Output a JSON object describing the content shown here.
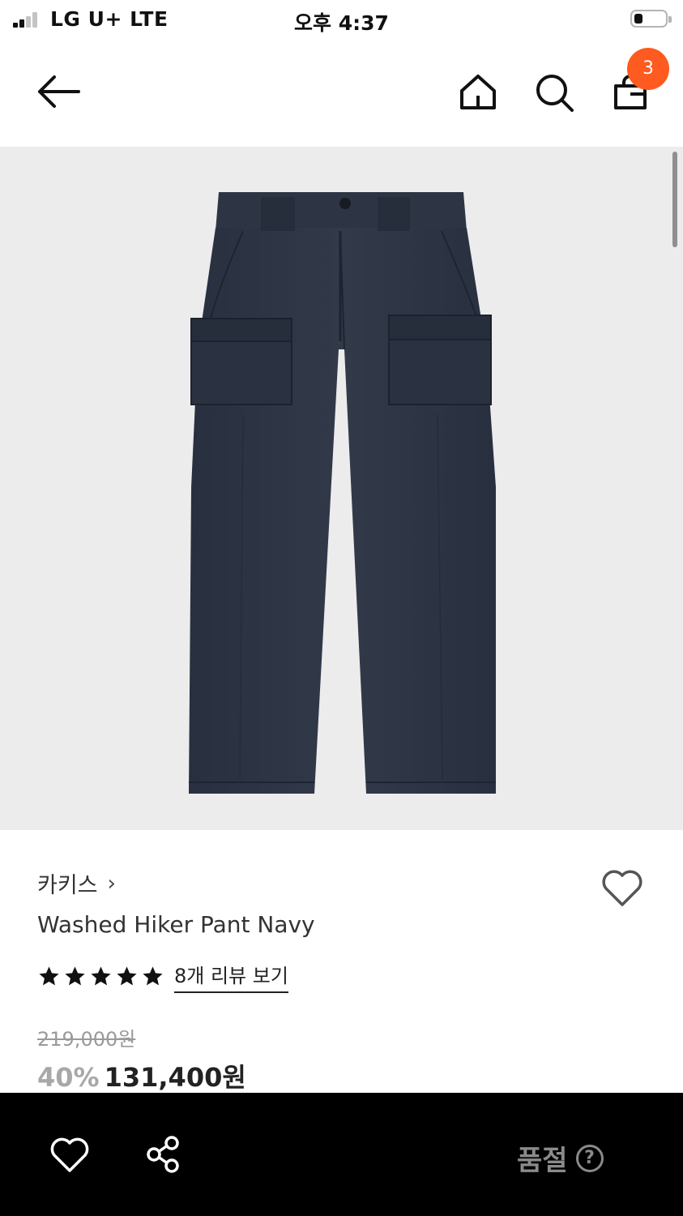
{
  "status_bar": {
    "carrier": "LG U+  LTE",
    "time": "오후 4:37",
    "battery_level": 0.28
  },
  "header": {
    "cart_count": "3"
  },
  "product": {
    "brand": "카키스",
    "name": "Washed Hiker Pant Navy",
    "rating": 5,
    "review_link": "8개 리뷰 보기",
    "original_price": "219,000원",
    "discount": "40%",
    "sale_price": "131,400원"
  },
  "bottom_bar": {
    "status_label": "품절",
    "help_symbol": "?"
  },
  "colors": {
    "accent": "#ff5a1f",
    "image_bg": "#ececec",
    "pants": "#2c3340"
  }
}
